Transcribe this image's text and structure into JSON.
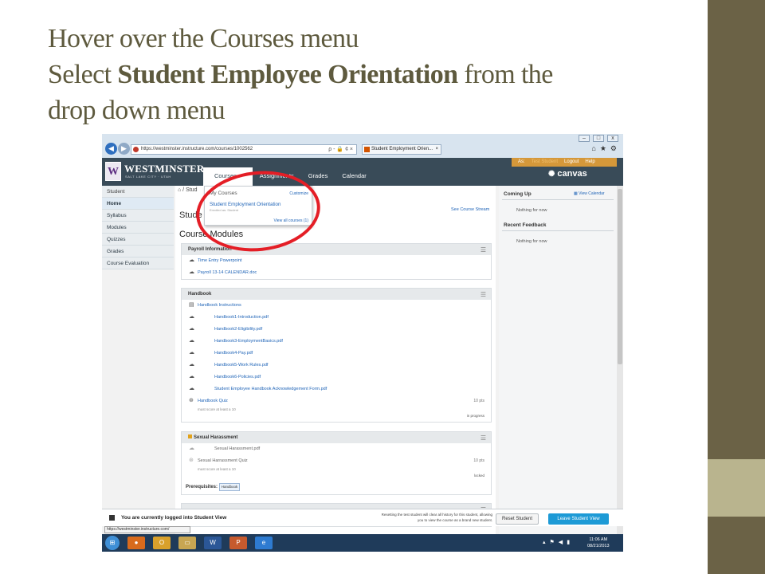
{
  "slide": {
    "title_line1": "Hover over the Courses menu",
    "title_line2_pre": "Select ",
    "title_line2_bold": "Student Employee Orientation",
    "title_line2_post": " from the",
    "title_line3": "drop down menu"
  },
  "browser": {
    "address": "https://westminster.instructure.com/courses/1002562",
    "address_tools": "ρ - 🔒 ¢ ×",
    "tab_title": "Student Employment Orien...",
    "tab_close": "×",
    "status_url": "https://westminster.instructure.com/",
    "window_controls": [
      "–",
      "□",
      "x"
    ]
  },
  "header": {
    "logo_letter": "W",
    "logo_text": "WESTMINSTER",
    "logo_sub": "SALT LAKE CITY · UTAH",
    "menu": [
      "Courses ▾",
      "Assignments",
      "Grades",
      "Calendar"
    ],
    "user_bar": {
      "as": "As:",
      "user": "Test Student",
      "logout": "Logout",
      "help": "Help"
    },
    "canvas_label": "canvas"
  },
  "leftnav": {
    "items": [
      "Student",
      "Home",
      "Syllabus",
      "Modules",
      "Quizzes",
      "Grades",
      "Course Evaluation"
    ]
  },
  "dropdown": {
    "heading": "My Courses",
    "customize": "Customize",
    "course": "Student Employment Orientation",
    "enrolled": "Enrolled as: Student",
    "view_all": "View all courses (1)"
  },
  "content": {
    "crumb": "⌂ / Stud",
    "course_title_start": "Stude",
    "course_title_end": "n",
    "stream_link": "See Course Stream",
    "modules_heading": "Course Modules",
    "modules": [
      {
        "title": "Payroll Information",
        "items": [
          "Time Entry Powerpoint",
          "Payroll 13-14 CALENDAR.doc"
        ]
      },
      {
        "title": "Handbook",
        "items": [
          "Handbook Instructions",
          "Handbook1-Introduction.pdf",
          "Handbook2-Eligibility.pdf",
          "Handbook3-EmploymentBasics.pdf",
          "Handbook4-Pay.pdf",
          "Handbook5-Work Rules.pdf",
          "Handbook6-Policies.pdf",
          "Student Employee Handbook Acknowledgement Form.pdf",
          "Handbook Quiz"
        ],
        "quiz_points": "10 pts",
        "quiz_note": "must score at least a 10",
        "status": "in progress"
      },
      {
        "title": "Sexual Harassment",
        "items": [
          "Sexual Harassment.pdf",
          "Sexual Harrassment Quiz"
        ],
        "quiz_points": "10 pts",
        "quiz_note": "must score at least a 10",
        "status": "locked",
        "prereq_label": "Prerequisites:",
        "prereq_value": "Handbook"
      }
    ]
  },
  "sidebar": {
    "coming_up": "Coming Up",
    "view_calendar": "View Calendar",
    "nothing1": "Nothing for now",
    "recent_feedback": "Recent Feedback",
    "nothing2": "Nothing for now"
  },
  "student_view": {
    "message": "You are currently logged into Student View",
    "note": "Resetting the test student will clear all history for this student, allowing you to view the course as a brand new student.",
    "reset": "Reset Student",
    "leave": "Leave Student View"
  },
  "taskbar": {
    "time": "11:06 AM",
    "date": "08/21/2013"
  }
}
